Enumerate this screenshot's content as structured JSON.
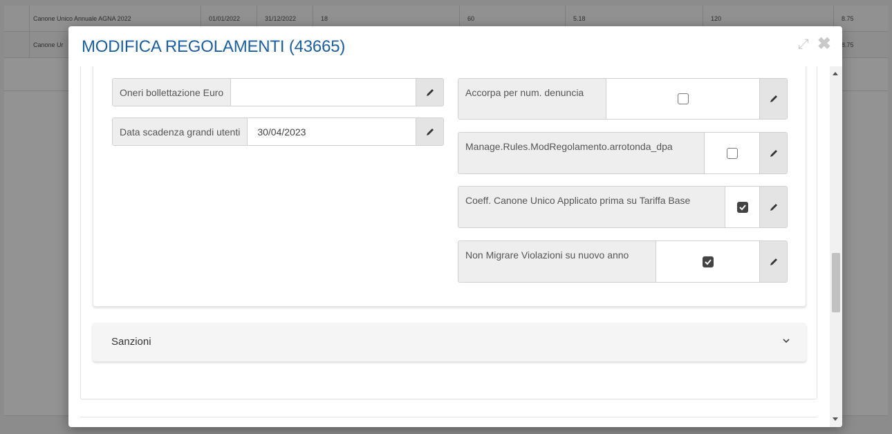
{
  "background_table": {
    "rows": [
      {
        "name": "Canone Unico Annuale AGNA 2022",
        "start": "01/01/2022",
        "end": "31/12/2022",
        "c1": "18",
        "c2": "60",
        "c3": "5.18",
        "c4": "120",
        "c5": "8.75"
      },
      {
        "name": "Canone Ur",
        "start": "",
        "end": "",
        "c1": "",
        "c2": "",
        "c3": "",
        "c4": "",
        "c5": "8.75"
      }
    ]
  },
  "modal": {
    "title": "MODIFICA REGOLAMENTI (43665)",
    "left_fields": [
      {
        "label": "Oneri bollettazione Euro",
        "value": ""
      },
      {
        "label": "Data scadenza grandi utenti",
        "value": "30/04/2023"
      }
    ],
    "right_fields": [
      {
        "label": "Accorpa per num. denuncia",
        "checked": false
      },
      {
        "label": "Manage.Rules.ModRegolamento.arrotonda_dpa",
        "checked": false
      },
      {
        "label": "Coeff. Canone Unico Applicato prima su Tariffa Base",
        "checked": true
      },
      {
        "label": "Non Migrare Violazioni su nuovo anno",
        "checked": true
      }
    ],
    "accordion": {
      "label": "Sanzioni"
    }
  },
  "icons": {
    "expand": "expand-icon",
    "close": "close-icon",
    "edit": "pencil-icon",
    "chevron": "chevron-down-icon"
  },
  "colors": {
    "title": "#1a5fa6",
    "label_bg": "#eeeeee",
    "edit_bg": "#e4e4e4"
  }
}
